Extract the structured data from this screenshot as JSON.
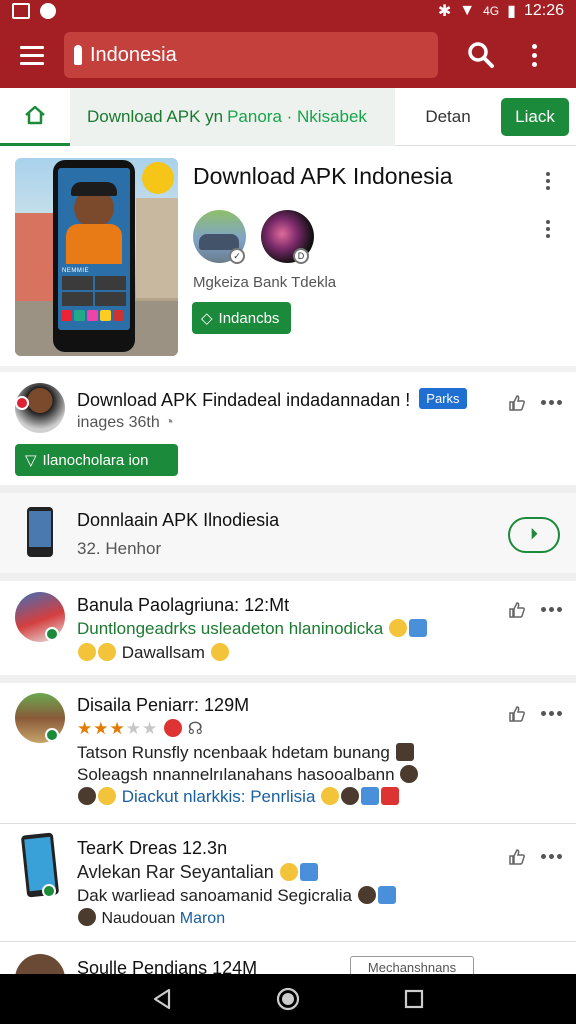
{
  "status": {
    "time": "12:26",
    "network": "4G"
  },
  "toolbar": {
    "search_text": "Indonesia"
  },
  "tabs": {
    "main_prefix": "Download APK yn",
    "main_highlight": "Panora · Nkisabek",
    "second": "Detan",
    "button": "Liack"
  },
  "card1": {
    "title": "Download APK Indonesia",
    "subtitle": "Mgkeiza Bank Tdekla",
    "button": "Indancbs",
    "phone_label": "NEMMIE"
  },
  "row1": {
    "title": "Download APK Findadeal indadannadan !",
    "tag": "Parks",
    "sub": "inages 36th",
    "button": "Ilanocholara ion"
  },
  "row2": {
    "title": "Donnlaain APK Ilnodiesia",
    "sub": "32. Henhor"
  },
  "row3": {
    "title": "Banula Paolagriuna: 12:Mt",
    "line1": "Duntlongeadrks usleadeton hlaninodicka",
    "line2": "Dawallsam"
  },
  "row4": {
    "title": "Disaila Peniarr: 129M",
    "line1": "Tatson Runsfly ncenbaak hdetam bunang",
    "line2": "Soleagsh nnannelrılanahans hasooalbann",
    "line3": "Diackut nlarkkis: Penrlisia"
  },
  "row5": {
    "title": "TearK Dreas  12.3n",
    "line1": "Avlekan Rar Seyantalian",
    "line2": "Dak warliead sanoamanid Segicralia",
    "line3": "Naudouan",
    "line3_blue": "Maron"
  },
  "row6": {
    "title": "Soulle Pendians  124M",
    "button": "Mechanshnans"
  },
  "colors": {
    "brand_red": "#a31f24",
    "green": "#1b8a3a",
    "blue": "#1e6fd1"
  },
  "icons": [
    "menu-icon",
    "location-pin-icon",
    "search-icon",
    "more-vert-icon",
    "home-icon",
    "tag-icon",
    "thumb-up-icon",
    "more-horiz-icon",
    "back-icon",
    "home-circle-icon",
    "recents-icon"
  ]
}
